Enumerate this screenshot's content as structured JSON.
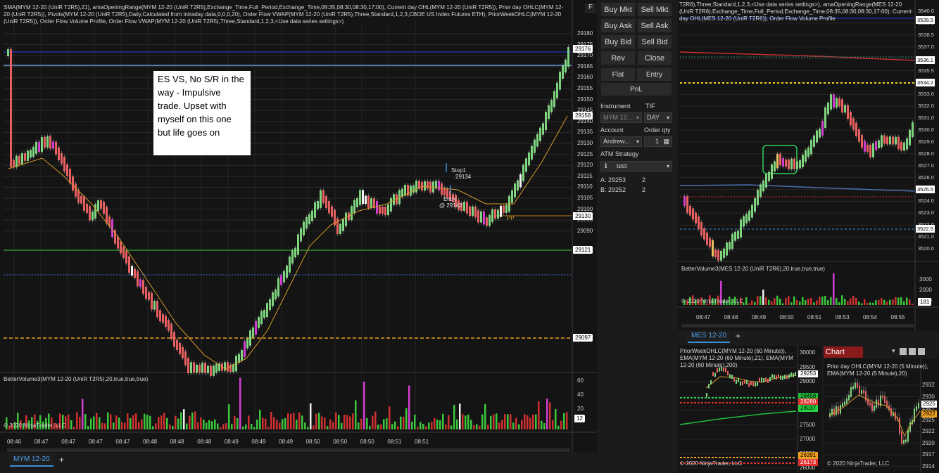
{
  "main_chart": {
    "indicators_text": "SMA(MYM 12-20 (UniR T2R5),21), amaOpeningRange(MYM 12-20 (UniR T2R5),Exchange_Time,Full_Period,Exchange_Time,08:35,08:30,08:30,17:00), Current day OHL(MYM 12-20 (UniR T2R5)), Prior day OHLC(MYM 12-20 (UniR T2R5)), Pivots(MYM 12-20 (UniR T2R5),Daily,Calculated from intraday data,0,0,0,20), Order Flow VWAP(MYM 12-20 (UniR T2R5),Three,Standard,1,2,3,CBOE US Index Futures ETH), PriorWeekOHLC(MYM 12-20 (UniR T2R5)), Order Flow Volume Profile, Order Flow VWAP(MYM 12-20 (UniR T2R5),Three,Standard,1,2,3,<Use data series settings>)",
    "f_button": "F",
    "annotation": "ES VS, No S/R in the way - Impulsive trade. Upset with myself on this one but life goes on",
    "price_ticks": [
      "29180",
      "29175",
      "29170",
      "29165",
      "29160",
      "29155",
      "29150",
      "29145",
      "29140",
      "29135",
      "29130",
      "29125",
      "29120",
      "29115",
      "29110",
      "29105",
      "29100",
      "29095",
      "29090"
    ],
    "tags": [
      {
        "label": "29176",
        "bg": "#ffffff",
        "fg": "#000000"
      },
      {
        "label": "29158",
        "bg": "#ffffff",
        "fg": "#000000"
      },
      {
        "label": "29130",
        "bg": "#ffffff",
        "fg": "#000000"
      },
      {
        "label": "29121",
        "bg": "#ffffff",
        "fg": "#000000"
      },
      {
        "label": "29097",
        "bg": "#ffffff",
        "fg": "#000000"
      }
    ],
    "pp_label": "PP",
    "stop_label": "Stop1",
    "stop_price": "29134",
    "entry_label": "Entry",
    "entry_price": "@ 29142",
    "volume_indicator": "BetterVolume3(MYM 12-20 (UniR T2R5),20,true,true,true)",
    "volume_ticks": [
      "60",
      "40",
      "20"
    ],
    "volume_tag": "12",
    "copyright": "© 2020 NinjaTrader, LLC",
    "time_ticks": [
      "08:46",
      "08:47",
      "08:47",
      "08:47",
      "08:47",
      "08:48",
      "08:48",
      "08:48",
      "08:49",
      "08:49",
      "08:49",
      "08:50",
      "08:50",
      "08:50",
      "08:51",
      "08:51"
    ],
    "tab_label": "MYM 12-20",
    "add_tab": "+"
  },
  "order_panel": {
    "buttons": [
      [
        "Buy Mkt",
        "Sell Mkt"
      ],
      [
        "Buy Ask",
        "Sell Ask"
      ],
      [
        "Buy Bid",
        "Sell Bid"
      ],
      [
        "Rev",
        "Close"
      ]
    ],
    "flat": "Flat",
    "entry": "Entry",
    "pnl": "PnL",
    "instrument_label": "Instrument",
    "tif_label": "TIF",
    "instrument_value": "MYM 12...",
    "tif_value": "DAY",
    "account_label": "Account",
    "order_qty_label": "Order qty",
    "account_value": "Andrew...",
    "order_qty_value": "1",
    "atm_label": "ATM Strategy",
    "atm_value": "test",
    "ask_label": "A:",
    "ask_price": "29253",
    "ask_qty": "2",
    "bid_label": "B:",
    "bid_price": "29252",
    "bid_qty": "2"
  },
  "mes_chart": {
    "indicators_text": "T2R6),Three,Standard,1,2,3,<Use data series settings>), amaOpeningRange(MES 12-20 (UniR T2R6),Exchange_Time,Full_Period,Exchange_Time,08:35,08:30,08:30,17:00), Current day OHL(MES 12-20 (UniR T2R6)), Order Flow Volume Profile",
    "price_ticks": [
      "3540.0",
      "3539.5",
      "3538.5",
      "3537.0",
      "3536.5",
      "3535.5",
      "3534.0",
      "3533.0",
      "3532.0",
      "3531.0",
      "3530.0",
      "3529.0",
      "3528.0",
      "3527.0",
      "3526.0",
      "3525.0",
      "3524.0",
      "3523.0",
      "3522.0",
      "3521.0",
      "3520.0"
    ],
    "tags": [
      {
        "label": "3539.5",
        "bg": "#ffffff",
        "fg": "#000000"
      },
      {
        "label": "3536.1",
        "bg": "#ffffff",
        "fg": "#000000"
      },
      {
        "label": "3534.2",
        "bg": "#ffffff",
        "fg": "#000000"
      },
      {
        "label": "3525.5",
        "bg": "#ffffff",
        "fg": "#000000"
      },
      {
        "label": "3522.5",
        "bg": "#ffffff",
        "fg": "#000000"
      }
    ],
    "volume_indicator": "BetterVolume3(MES 12-20 (UniR T2R6),20,true,true,true)",
    "volume_ticks": [
      "3000",
      "2000",
      "1000"
    ],
    "volume_tag": "181",
    "copyright": "© 2020 NinjaTrader, LLC",
    "time_ticks": [
      "08:47",
      "08:48",
      "08:49",
      "08:50",
      "08:51",
      "08:53",
      "08:54",
      "08:55"
    ],
    "tab_label": "MES 12-20",
    "add_tab": "+"
  },
  "week_chart": {
    "indicators_text": "PriorWeekOHLC(MYM 12-20 (60 Minute)), EMA(MYM 12-20 (60 Minute),21), EMA(MYM 12-20 (60 Minute),200)",
    "price_ticks": [
      "30000",
      "29500",
      "29000",
      "28500",
      "28000",
      "27500",
      "27000",
      "26500",
      "26000"
    ],
    "tags": [
      {
        "label": "29253",
        "bg": "#ffffff",
        "fg": "#000000"
      },
      {
        "label": "28458",
        "bg": "#1fbe3c",
        "fg": "#000000"
      },
      {
        "label": "28280",
        "bg": "#e03030",
        "fg": "#ffffff"
      },
      {
        "label": "28037",
        "bg": "#25d041",
        "fg": "#000000"
      },
      {
        "label": "26391",
        "bg": "#f0a020",
        "fg": "#000000"
      },
      {
        "label": "26173",
        "bg": "#e03030",
        "fg": "#ffffff"
      }
    ],
    "copyright": "© 2020 NinjaTrader, LLC"
  },
  "five_chart": {
    "header_label": "Chart",
    "indicators_text": "Prior day OHLC(MYM 12-20 (5 Minute)), EMA(MYM 12-20 (5 Minute),20)",
    "price_ticks": [
      "2932",
      "2930",
      "2927",
      "2925",
      "2922",
      "2920",
      "2917",
      "2914",
      "2912"
    ],
    "tags": [
      {
        "label": "2925",
        "bg": "#ffffff",
        "fg": "#000000"
      },
      {
        "label": "2922",
        "bg": "#f0a020",
        "fg": "#000000"
      }
    ],
    "copyright": "© 2020 NinjaTrader, LLC"
  }
}
